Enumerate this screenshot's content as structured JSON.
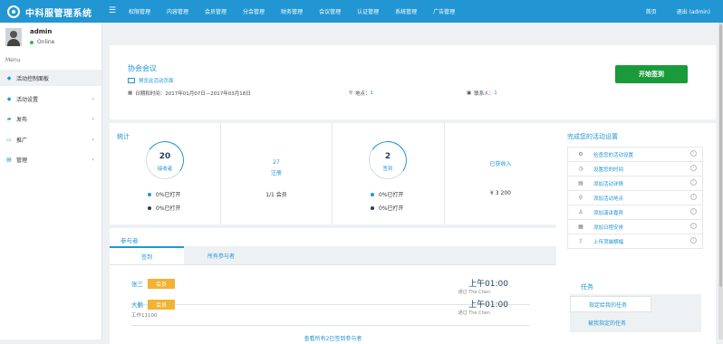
{
  "app": {
    "title": "中科服管理系统"
  },
  "topnav": {
    "items": [
      "权限管理",
      "内容管理",
      "会员管理",
      "分会管理",
      "财务管理",
      "会议管理",
      "认证管理",
      "系统管理",
      "广告管理"
    ],
    "home": "首页",
    "logout": "退出 (admin)"
  },
  "user": {
    "name": "admin",
    "status": "Online"
  },
  "sidebar": {
    "menu_label": "Menu",
    "items": [
      {
        "label": "活动控制面板",
        "icon": "flame-icon",
        "active": true,
        "has_submenu": false
      },
      {
        "label": "活动设置",
        "icon": "flame-icon",
        "active": false,
        "has_submenu": true
      },
      {
        "label": "发布",
        "icon": "truck-icon",
        "active": false,
        "has_submenu": true
      },
      {
        "label": "推广",
        "icon": "briefcase-icon",
        "active": false,
        "has_submenu": true
      },
      {
        "label": "管理",
        "icon": "database-icon",
        "active": false,
        "has_submenu": true
      }
    ]
  },
  "event": {
    "title": "协会会议",
    "preview_link": "预览此活动页面",
    "date_label": "日期和时间：",
    "date_value": "2017年01月07日—2017年03月18日",
    "location_label": "地点：",
    "location_value": "1",
    "contact_label": "联系人：",
    "contact_value": "1",
    "start_button": "开始签到"
  },
  "stats": {
    "label": "统计",
    "cells": [
      {
        "circle_value": "20",
        "circle_label": "接收者",
        "legend": [
          "0%已打开",
          "0%已打开"
        ]
      },
      {
        "count": "27",
        "count_label": "注册",
        "detail": "1/1 会员"
      },
      {
        "circle_value": "2",
        "circle_label": "签到",
        "legend": [
          "0%已打开",
          "0%已打开"
        ]
      },
      {
        "heading": "已获收入",
        "amount": "¥ 3 200"
      }
    ],
    "legend_colors": [
      "#2196d3",
      "#1d3f5e"
    ]
  },
  "participants": {
    "title": "参与者",
    "tabs": [
      "签到",
      "所有参与者"
    ],
    "rows": [
      {
        "name": "张三",
        "badge": "会员",
        "job": "",
        "time": "上午01:00",
        "by": "通过 The Chen"
      },
      {
        "name": "大鹏",
        "badge": "会员",
        "job": "工作11100",
        "time": "上午01:00",
        "by": "通过 The Chen"
      }
    ],
    "view_all": "查看所有2已签到参与者"
  },
  "setup": {
    "title": "完成您的活动设置",
    "items": [
      {
        "label": "检查您的活动设置",
        "icon": "gear-icon"
      },
      {
        "label": "设置您的时间",
        "icon": "clock-icon"
      },
      {
        "label": "添加活动详情",
        "icon": "list-icon"
      },
      {
        "label": "添加活动地点",
        "icon": "map-pin-icon"
      },
      {
        "label": "添加演讲嘉宾",
        "icon": "user-icon"
      },
      {
        "label": "添加日程安排",
        "icon": "calendar-icon"
      },
      {
        "label": "上传顶端横幅",
        "icon": "upload-icon"
      }
    ]
  },
  "tasks": {
    "title": "任务",
    "items": [
      "指定给我的任务",
      "被我指定的任务"
    ]
  },
  "colors": {
    "primary": "#2196d3",
    "start_button": "#1a9a3a",
    "badge": "#f2b233"
  }
}
